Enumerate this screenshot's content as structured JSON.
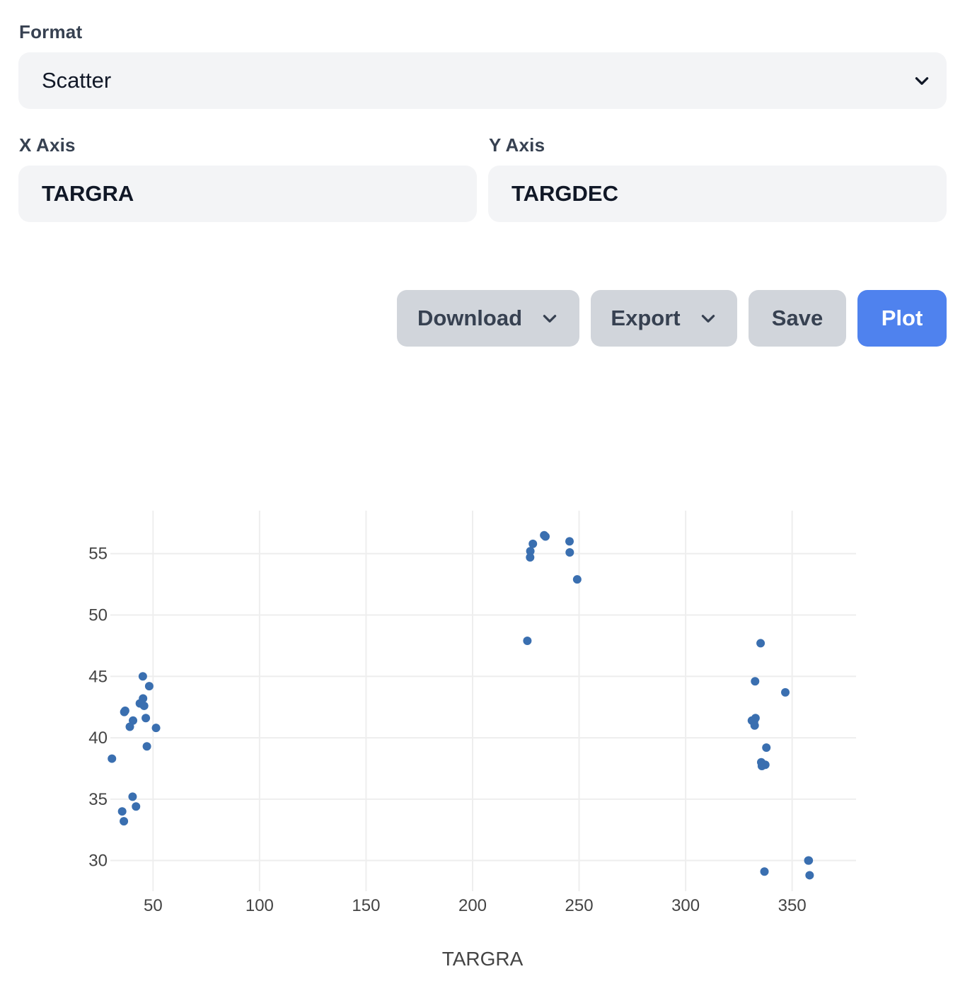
{
  "form": {
    "format_label": "Format",
    "format_value": "Scatter",
    "x_axis_label": "X Axis",
    "x_axis_value": "TARGRA",
    "y_axis_label": "Y Axis",
    "y_axis_value": "TARGDEC"
  },
  "actions": {
    "download_label": "Download",
    "export_label": "Export",
    "save_label": "Save",
    "plot_label": "Plot"
  },
  "icons": {
    "select_chevron": "chevron-down-icon",
    "download_chevron": "chevron-down-icon",
    "export_chevron": "chevron-down-icon"
  },
  "colors": {
    "primary": "#4f82ee",
    "marker": "#3a6fb0",
    "field_bg": "#f3f4f6",
    "button_bg": "#d1d5db"
  },
  "chart_data": {
    "type": "scatter",
    "title": "",
    "xlabel": "TARGRA",
    "ylabel": "",
    "xlim": [
      20,
      380
    ],
    "ylim": [
      27.5,
      58.5
    ],
    "xticks": [
      50,
      100,
      150,
      200,
      250,
      300,
      350
    ],
    "yticks": [
      30,
      35,
      40,
      45,
      50,
      55
    ],
    "grid": true,
    "legend": "none",
    "series": [
      {
        "points": [
          [
            45.2,
            45.0
          ],
          [
            48.2,
            44.2
          ],
          [
            45.3,
            43.2
          ],
          [
            43.8,
            42.8
          ],
          [
            45.8,
            42.6
          ],
          [
            36.5,
            42.1
          ],
          [
            36.9,
            42.2
          ],
          [
            40.6,
            41.4
          ],
          [
            46.6,
            41.6
          ],
          [
            39.1,
            40.9
          ],
          [
            51.4,
            40.8
          ],
          [
            47.1,
            39.3
          ],
          [
            30.7,
            38.3
          ],
          [
            40.4,
            35.2
          ],
          [
            42.0,
            34.4
          ],
          [
            35.5,
            34.0
          ],
          [
            36.3,
            33.2
          ],
          [
            233.6,
            56.5
          ],
          [
            234.2,
            56.4
          ],
          [
            245.5,
            56.0
          ],
          [
            228.3,
            55.8
          ],
          [
            227.1,
            55.2
          ],
          [
            245.6,
            55.1
          ],
          [
            227.0,
            54.7
          ],
          [
            249.1,
            52.9
          ],
          [
            225.7,
            47.9
          ],
          [
            335.2,
            47.7
          ],
          [
            332.6,
            44.6
          ],
          [
            346.8,
            43.7
          ],
          [
            332.8,
            41.6
          ],
          [
            331.1,
            41.4
          ],
          [
            332.1,
            41.3
          ],
          [
            332.4,
            41.0
          ],
          [
            337.9,
            39.2
          ],
          [
            335.5,
            38.0
          ],
          [
            336.5,
            37.8
          ],
          [
            337.4,
            37.8
          ],
          [
            335.8,
            37.7
          ],
          [
            357.8,
            30.0
          ],
          [
            357.6,
            30.0
          ],
          [
            337.0,
            29.1
          ],
          [
            358.2,
            28.8
          ]
        ]
      }
    ]
  }
}
